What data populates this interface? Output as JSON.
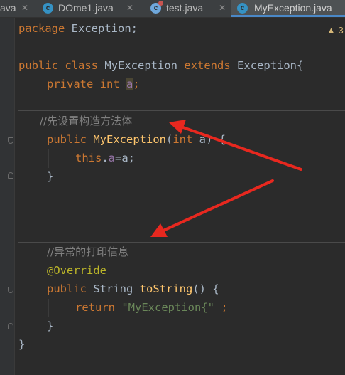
{
  "tabs": [
    {
      "label": "ava",
      "active": false,
      "icon": "none"
    },
    {
      "label": "DOme1.java",
      "active": false,
      "icon": "java-class-icon"
    },
    {
      "label": "test.java",
      "active": false,
      "icon": "java-class-error-icon"
    },
    {
      "label": "MyException.java",
      "active": true,
      "icon": "java-class-icon"
    }
  ],
  "tab_close_glyph": "✕",
  "warning": {
    "icon": "warning-triangle-icon",
    "glyph": "▲",
    "count": "3"
  },
  "code": {
    "l1_kw": "package",
    "l1_rest": " Exception;",
    "l3_kw1": "public",
    "l3_kw2": "class",
    "l3_cls": "MyException",
    "l3_kw3": "extends",
    "l3_rest": "Exception{",
    "l4_kw1": "private",
    "l4_kw2": "int",
    "l4_fld": "a",
    "l4_semi": ";",
    "l6_comment": "//先设置构造方法体",
    "l7_kw1": "public",
    "l7_fn": "MyException",
    "l7_p1": "(",
    "l7_kw2": "int",
    "l7_p2": " a) {",
    "l8_kw": "this",
    "l8_dot": ".",
    "l8_fld": "a",
    "l8_rest": "=a;",
    "l9_brace": "}",
    "l13_comment": "//异常的打印信息",
    "l14_ann": "@Override",
    "l15_kw": "public",
    "l15_cls": " String ",
    "l15_fn": "toString",
    "l15_rest": "() {",
    "l16_kw": "return",
    "l16_str": "\"MyException{\"",
    "l16_rest": " ;",
    "l17_brace": "}",
    "l18_brace": "}"
  },
  "colors": {
    "background": "#2b2b2b",
    "keyword": "#cc7832",
    "function": "#ffc66d",
    "field": "#9876aa",
    "string": "#6a8759",
    "comment": "#808080",
    "annotation": "#bbb529",
    "arrow": "#e8281f"
  }
}
